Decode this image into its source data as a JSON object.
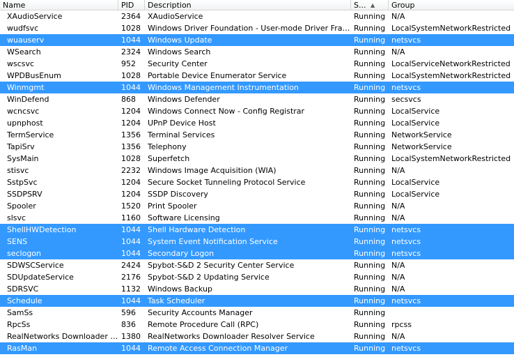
{
  "columns": [
    {
      "label": "Name"
    },
    {
      "label": "PID"
    },
    {
      "label": "Description"
    },
    {
      "label": "S..."
    },
    {
      "label": "Group"
    }
  ],
  "selected_color": "#3399ff",
  "rows": [
    {
      "name": "XAudioService",
      "pid": "2364",
      "description": "XAudioService",
      "status": "Running",
      "group": "N/A",
      "selected": false
    },
    {
      "name": "wudfsvc",
      "pid": "1028",
      "description": "Windows Driver Foundation - User-mode Driver Framework",
      "status": "Running",
      "group": "LocalSystemNetworkRestricted",
      "selected": false
    },
    {
      "name": "wuauserv",
      "pid": "1044",
      "description": "Windows Update",
      "status": "Running",
      "group": "netsvcs",
      "selected": true
    },
    {
      "name": "WSearch",
      "pid": "2324",
      "description": "Windows Search",
      "status": "Running",
      "group": "N/A",
      "selected": false
    },
    {
      "name": "wscsvc",
      "pid": "952",
      "description": "Security Center",
      "status": "Running",
      "group": "LocalServiceNetworkRestricted",
      "selected": false
    },
    {
      "name": "WPDBusEnum",
      "pid": "1028",
      "description": "Portable Device Enumerator Service",
      "status": "Running",
      "group": "LocalSystemNetworkRestricted",
      "selected": false
    },
    {
      "name": "Winmgmt",
      "pid": "1044",
      "description": "Windows Management Instrumentation",
      "status": "Running",
      "group": "netsvcs",
      "selected": true
    },
    {
      "name": "WinDefend",
      "pid": "868",
      "description": "Windows Defender",
      "status": "Running",
      "group": "secsvcs",
      "selected": false
    },
    {
      "name": "wcncsvc",
      "pid": "1204",
      "description": "Windows Connect Now - Config Registrar",
      "status": "Running",
      "group": "LocalService",
      "selected": false
    },
    {
      "name": "upnphost",
      "pid": "1204",
      "description": "UPnP Device Host",
      "status": "Running",
      "group": "LocalService",
      "selected": false
    },
    {
      "name": "TermService",
      "pid": "1356",
      "description": "Terminal Services",
      "status": "Running",
      "group": "NetworkService",
      "selected": false
    },
    {
      "name": "TapiSrv",
      "pid": "1356",
      "description": "Telephony",
      "status": "Running",
      "group": "NetworkService",
      "selected": false
    },
    {
      "name": "SysMain",
      "pid": "1028",
      "description": "Superfetch",
      "status": "Running",
      "group": "LocalSystemNetworkRestricted",
      "selected": false
    },
    {
      "name": "stisvc",
      "pid": "2232",
      "description": "Windows Image Acquisition (WIA)",
      "status": "Running",
      "group": "N/A",
      "selected": false
    },
    {
      "name": "SstpSvc",
      "pid": "1204",
      "description": "Secure Socket Tunneling Protocol Service",
      "status": "Running",
      "group": "LocalService",
      "selected": false
    },
    {
      "name": "SSDPSRV",
      "pid": "1204",
      "description": "SSDP Discovery",
      "status": "Running",
      "group": "LocalService",
      "selected": false
    },
    {
      "name": "Spooler",
      "pid": "1520",
      "description": "Print Spooler",
      "status": "Running",
      "group": "N/A",
      "selected": false
    },
    {
      "name": "slsvc",
      "pid": "1160",
      "description": "Software Licensing",
      "status": "Running",
      "group": "N/A",
      "selected": false
    },
    {
      "name": "ShellHWDetection",
      "pid": "1044",
      "description": "Shell Hardware Detection",
      "status": "Running",
      "group": "netsvcs",
      "selected": true
    },
    {
      "name": "SENS",
      "pid": "1044",
      "description": "System Event Notification Service",
      "status": "Running",
      "group": "netsvcs",
      "selected": true
    },
    {
      "name": "seclogon",
      "pid": "1044",
      "description": "Secondary Logon",
      "status": "Running",
      "group": "netsvcs",
      "selected": true
    },
    {
      "name": "SDWSCService",
      "pid": "2424",
      "description": "Spybot-S&D 2 Security Center Service",
      "status": "Running",
      "group": "N/A",
      "selected": false
    },
    {
      "name": "SDUpdateService",
      "pid": "2176",
      "description": "Spybot-S&D 2 Updating Service",
      "status": "Running",
      "group": "N/A",
      "selected": false
    },
    {
      "name": "SDRSVC",
      "pid": "1132",
      "description": "Windows Backup",
      "status": "Running",
      "group": "N/A",
      "selected": false
    },
    {
      "name": "Schedule",
      "pid": "1044",
      "description": "Task Scheduler",
      "status": "Running",
      "group": "netsvcs",
      "selected": true
    },
    {
      "name": "SamSs",
      "pid": "596",
      "description": "Security Accounts Manager",
      "status": "Running",
      "group": "",
      "selected": false
    },
    {
      "name": "RpcSs",
      "pid": "836",
      "description": "Remote Procedure Call (RPC)",
      "status": "Running",
      "group": "rpcss",
      "selected": false
    },
    {
      "name": "RealNetworks Downloader Re...",
      "pid": "1380",
      "description": "RealNetworks Downloader Resolver Service",
      "status": "Running",
      "group": "N/A",
      "selected": false
    },
    {
      "name": "RasMan",
      "pid": "1044",
      "description": "Remote Access Connection Manager",
      "status": "Running",
      "group": "netsvcs",
      "selected": true
    }
  ]
}
